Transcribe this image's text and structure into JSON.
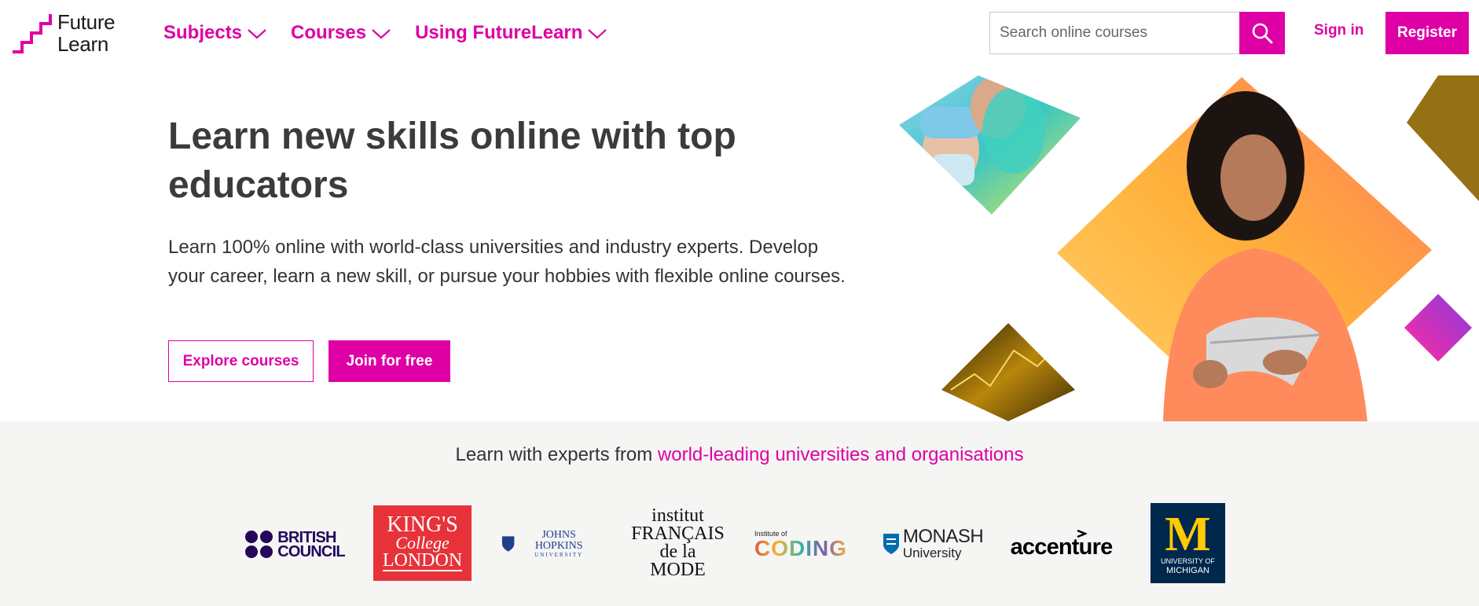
{
  "header": {
    "logo_text_line1": "Future",
    "logo_text_line2": "Learn",
    "nav": [
      {
        "label": "Subjects"
      },
      {
        "label": "Courses"
      },
      {
        "label": "Using FutureLearn"
      }
    ],
    "search_placeholder": "Search online courses",
    "sign_in": "Sign in",
    "register": "Register"
  },
  "hero": {
    "title": "Learn new skills online with top educators",
    "description": "Learn 100% online with world-class universities and industry experts. Develop your career, learn a new skill, or pursue your hobbies with flexible online courses.",
    "explore_button": "Explore courses",
    "join_button": "Join for free"
  },
  "partners": {
    "heading_prefix": "Learn with experts from ",
    "heading_link": "world-leading universities and organisations",
    "logos": [
      {
        "name": "BRITISH COUNCIL",
        "line1": "BRITISH",
        "line2": "COUNCIL"
      },
      {
        "name": "KING'S College LONDON",
        "line1": "KING'S",
        "line2": "College",
        "line3": "LONDON"
      },
      {
        "name": "JOHNS HOPKINS UNIVERSITY",
        "line1": "JOHNS HOPKINS",
        "line2": "UNIVERSITY"
      },
      {
        "name": "institut FRANÇAIS de la MODE",
        "line1": "institut",
        "line2": "FRANÇAIS",
        "line3": "de la",
        "line4": "MODE"
      },
      {
        "name": "Institute of CODING",
        "line1": "Institute of",
        "line2": "CODING"
      },
      {
        "name": "MONASH University",
        "line1": "MONASH",
        "line2": "University"
      },
      {
        "name": "accenture",
        "line1": "accenture"
      },
      {
        "name": "UNIVERSITY OF MICHIGAN",
        "line1": "M",
        "line2": "UNIVERSITY OF",
        "line3": "MICHIGAN"
      }
    ]
  },
  "colors": {
    "brand": "#de00a5",
    "text": "#333333",
    "band": "#f5f5f4"
  }
}
